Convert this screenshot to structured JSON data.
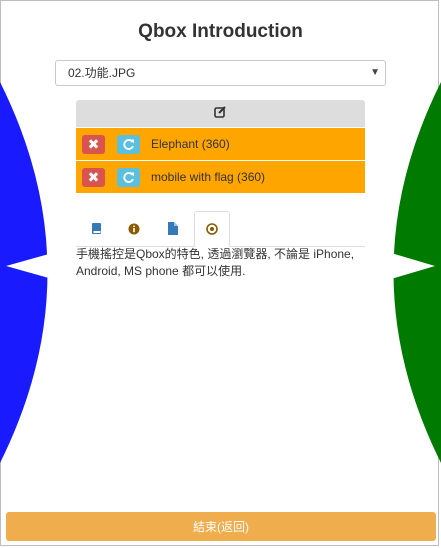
{
  "title": "Qbox Introduction",
  "file_select": {
    "selected": "02.功能.JPG"
  },
  "panel": {
    "items": [
      {
        "label": "Elephant (360)"
      },
      {
        "label": "mobile with flag (360)"
      }
    ]
  },
  "tabs": [
    {
      "icon": "book-icon",
      "active": false
    },
    {
      "icon": "info-circle-icon",
      "active": false
    },
    {
      "icon": "file-icon",
      "active": false
    },
    {
      "icon": "target-circle-icon",
      "active": true
    }
  ],
  "content": {
    "text": "手機搖控是Qbox的特色, 透過瀏覽器, 不論是 iPhone, Android, MS phone 都可以使用."
  },
  "footer": {
    "end_label": "結束(返回)"
  },
  "colors": {
    "left_nav": "#1a1aff",
    "right_nav": "#007a00",
    "item_row": "#ffa500",
    "delete": "#d9534f",
    "reload": "#5bc0de",
    "end_button": "#f0ad4e",
    "tab_icon": "#337ab7",
    "tab_icon_active": "#8a5a00"
  }
}
